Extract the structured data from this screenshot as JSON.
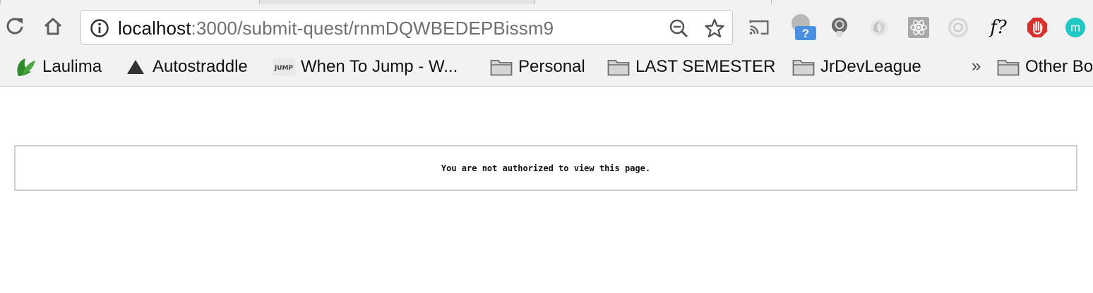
{
  "browser": {
    "address_bar": {
      "host": "localhost",
      "rest": ":3000/submit-quest/rnmDQWBEDEPBissm9"
    },
    "extensions": [
      {
        "name": "cast-icon"
      },
      {
        "name": "help-extension-icon",
        "badge": "?"
      },
      {
        "name": "lightbulb-icon"
      },
      {
        "name": "swirl-extension-icon"
      },
      {
        "name": "react-devtools-icon"
      },
      {
        "name": "ring-extension-icon"
      },
      {
        "name": "fonts-extension-icon",
        "label": "f?"
      },
      {
        "name": "adblock-icon"
      },
      {
        "name": "m-extension-icon",
        "label": "m"
      }
    ]
  },
  "bookmarks": {
    "items": [
      {
        "label": "Laulima"
      },
      {
        "label": "Autostraddle"
      },
      {
        "label": "When To Jump - W...",
        "favicon_text": "JUMP"
      },
      {
        "label": "Personal"
      },
      {
        "label": "LAST SEMESTER"
      },
      {
        "label": "JrDevLeague"
      }
    ],
    "overflow": "»",
    "other_label": "Other Bo"
  },
  "page": {
    "message": "You are not authorized to view this page."
  },
  "colors": {
    "chrome_bg": "#f2f2f2",
    "adblock_red": "#d9302c",
    "teal": "#1fc8c3",
    "help_blue": "#4a90e2"
  }
}
